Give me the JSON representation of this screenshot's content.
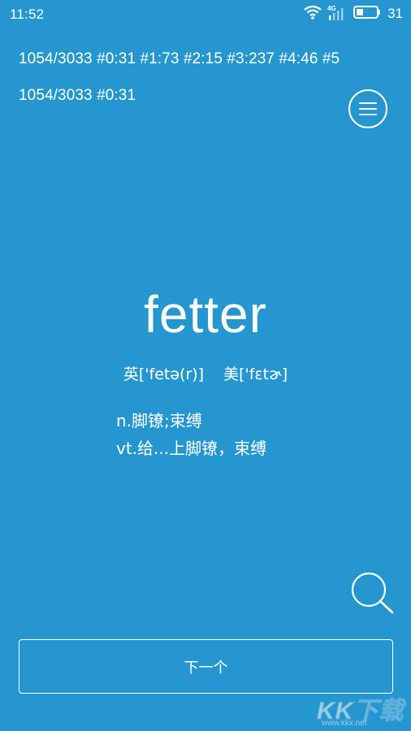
{
  "status_bar": {
    "time": "11:52",
    "network": "4G",
    "battery_level": "31"
  },
  "stats": {
    "line1": "1054/3033  #0:31  #1:73  #2:15  #3:237  #4:46  #5",
    "line2": "1054/3033  #0:31"
  },
  "card": {
    "word": "fetter",
    "phonetic_uk": "英['fetə(r)]",
    "phonetic_us": "美['fɛtɚ]",
    "definitions": [
      "n.脚镣;束缚",
      "vt.给...上脚镣，束缚"
    ]
  },
  "next_button": {
    "label": "下一个"
  },
  "icons": {
    "menu": "menu-icon",
    "search": "search-icon",
    "wifi": "wifi-icon",
    "signal": "signal-icon",
    "battery": "battery-icon"
  },
  "watermark": {
    "text": "KK下载",
    "url": "www.kkx.net"
  },
  "colors": {
    "background": "#2596cf",
    "foreground": "#ffffff"
  }
}
